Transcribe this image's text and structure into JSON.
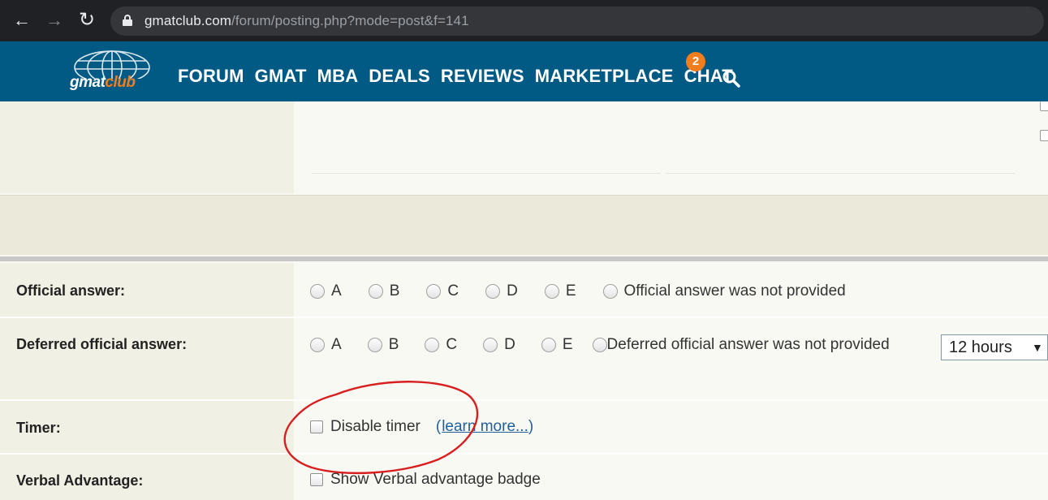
{
  "browser": {
    "url_domain": "gmatclub.com",
    "url_path": "/forum/posting.php?mode=post&f=141"
  },
  "header": {
    "logo_text_1": "gmat",
    "logo_text_2": "club",
    "nav": [
      "FORUM",
      "GMAT",
      "MBA",
      "DEALS",
      "REVIEWS",
      "MARKETPLACE",
      "CHAT"
    ],
    "chat_badge": "2",
    "brand_color": "#005a83",
    "accent_color": "#f07d1e"
  },
  "form": {
    "official_answer": {
      "label": "Official answer:",
      "options": [
        "A",
        "B",
        "C",
        "D",
        "E"
      ],
      "none_label": "Official answer was not provided"
    },
    "deferred_answer": {
      "label": "Deferred official answer:",
      "options": [
        "A",
        "B",
        "C",
        "D",
        "E"
      ],
      "none_label": "Deferred official answer was not provided",
      "delay_select": "12 hours",
      "select_arrow": "▼"
    },
    "timer": {
      "label": "Timer:",
      "checkbox_label": "Disable timer",
      "learn_open": "(",
      "learn_link": "learn more...",
      "learn_close": ")"
    },
    "verbal": {
      "label": "Verbal Advantage:",
      "checkbox_label": "Show Verbal advantage badge"
    }
  },
  "icons": {
    "back": "←",
    "forward": "→",
    "reload": "↻"
  }
}
